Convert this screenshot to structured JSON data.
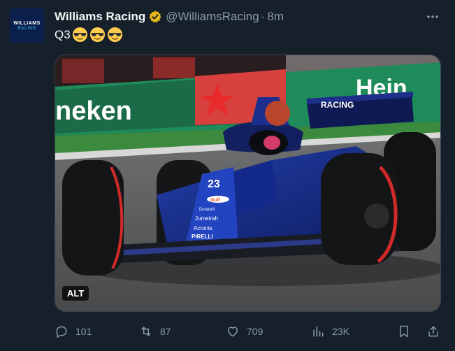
{
  "tweet": {
    "author_name": "Williams Racing",
    "handle": "@WilliamsRacing",
    "separator": "·",
    "time": "8m",
    "text": "Q3",
    "emoji": [
      "smiling-face-with-sunglasses",
      "smiling-face-with-sunglasses",
      "smiling-face-with-sunglasses"
    ],
    "avatar": {
      "line1": "WILLIAMS",
      "line2": "RACING"
    },
    "media": {
      "alt_badge": "ALT",
      "car_number": "23",
      "livery_text": "RACING",
      "sponsors": [
        "Gulf",
        "Duracell",
        "Jumeirah",
        "Acronis",
        "PIRELLI"
      ],
      "banner_text_left": "neken",
      "banner_text_right": "Hein"
    },
    "actions": {
      "replies": "101",
      "retweets": "87",
      "likes": "709",
      "views": "23K"
    },
    "colors": {
      "background": "#15202b",
      "secondary_text": "#8b98a5",
      "verified_gold": "#e2b719",
      "livery_blue": "#1c3fb7"
    },
    "icons": [
      "verified-badge-icon",
      "more-icon",
      "reply-icon",
      "retweet-icon",
      "like-icon",
      "views-icon",
      "bookmark-icon",
      "share-icon"
    ]
  }
}
